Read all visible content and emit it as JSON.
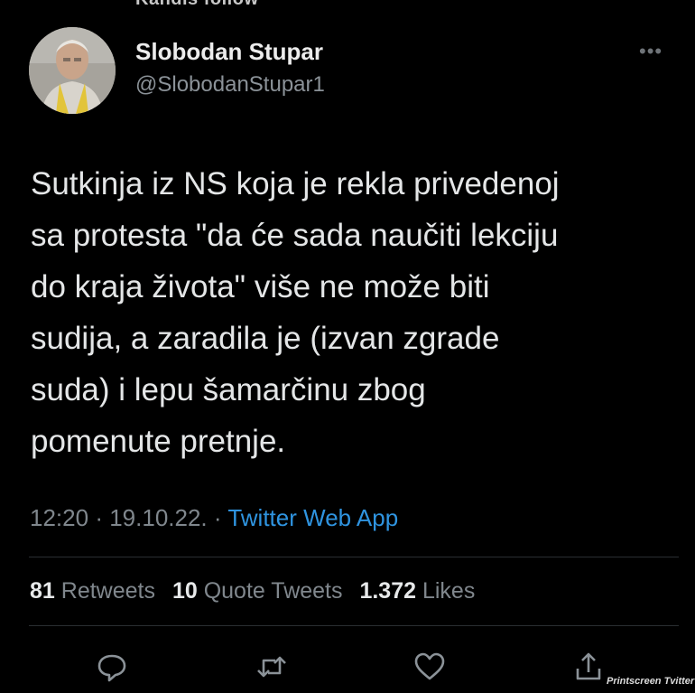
{
  "header": {
    "partial_label": "Kandis follow"
  },
  "tweet": {
    "author_name": "Slobodan Stupar",
    "author_handle": "@SlobodanStupar1",
    "more_label": "•••",
    "text": "Sutkinja iz NS koja je rekla privedenoj\nsa protesta \"da će sada naučiti lekciju\ndo kraja života\" više ne može biti\nsudija, a zaradila je (izvan zgrade\nsuda) i lepu šamarčinu zbog\npomenute pretnje.",
    "time": "12:20",
    "date": "19.10.22.",
    "separator": "·",
    "source": "Twitter Web App"
  },
  "stats": {
    "retweets_count": "81",
    "retweets_label": "Retweets",
    "quotes_count": "10",
    "quotes_label": "Quote Tweets",
    "likes_count": "1.372",
    "likes_label": "Likes"
  },
  "actions": {
    "icons": [
      "reply-icon",
      "retweet-icon",
      "like-icon",
      "share-icon"
    ]
  },
  "footer": {
    "credit": "Printscreen Tvitter"
  },
  "colors": {
    "background": "#000000",
    "text": "#e7e9ea",
    "muted": "#80878d",
    "link": "#2f94e0"
  }
}
